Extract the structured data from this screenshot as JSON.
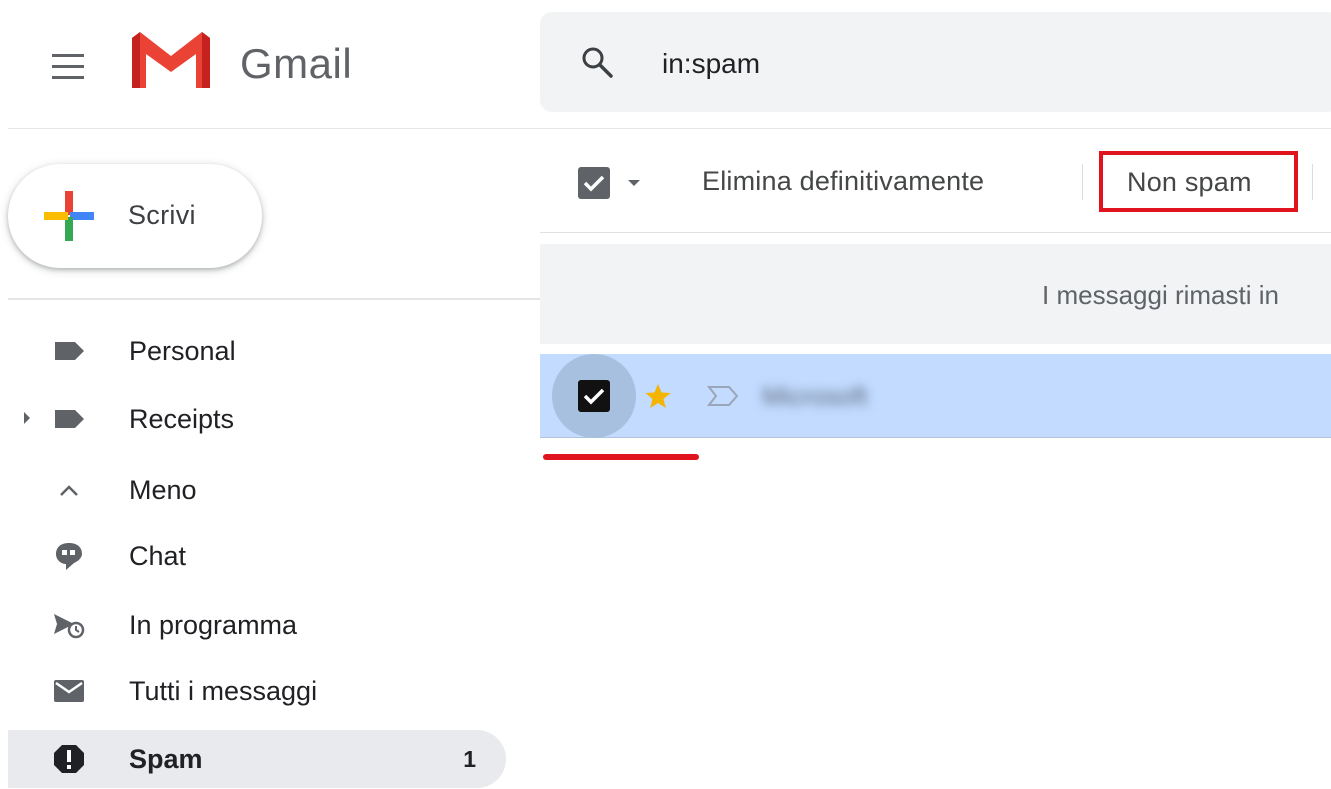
{
  "app": {
    "name": "Gmail"
  },
  "search": {
    "query": "in:spam"
  },
  "compose": {
    "label": "Scrivi"
  },
  "sidebar": {
    "items": [
      {
        "label": "Personal",
        "icon": "label-icon",
        "count": ""
      },
      {
        "label": "Receipts",
        "icon": "label-icon",
        "count": ""
      },
      {
        "label": "Meno",
        "icon": "chevron-up-icon",
        "count": ""
      },
      {
        "label": "Chat",
        "icon": "chat-icon",
        "count": ""
      },
      {
        "label": "In programma",
        "icon": "scheduled-icon",
        "count": ""
      },
      {
        "label": "Tutti i messaggi",
        "icon": "mail-icon",
        "count": ""
      },
      {
        "label": "Spam",
        "icon": "spam-icon",
        "count": "1"
      }
    ]
  },
  "toolbar": {
    "delete_label": "Elimina definitivamente",
    "not_spam_label": "Non spam"
  },
  "banner": {
    "text": "I messaggi rimasti in"
  },
  "messages": [
    {
      "sender": "Microsoft",
      "selected": true,
      "starred": true
    }
  ],
  "colors": {
    "highlight_red": "#e0141e",
    "selected_row": "#c2dbff",
    "active_nav": "#e8eaed",
    "star": "#f4b400"
  }
}
